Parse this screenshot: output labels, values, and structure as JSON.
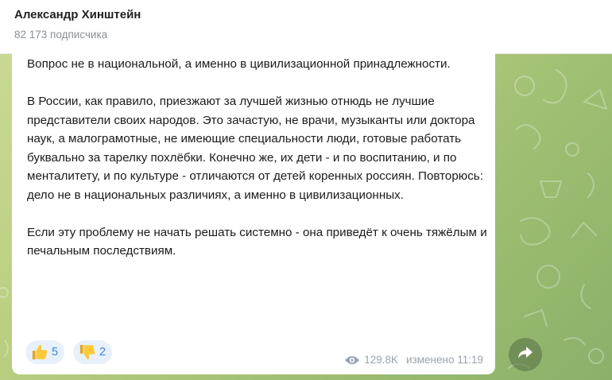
{
  "header": {
    "channel_name": "Александр Хинштейн",
    "subscribers": "82 173 подписчика"
  },
  "message": {
    "paragraphs": [
      "Вопрос не в национальной, а именно в цивилизационной принадлежности.",
      "В России, как правило, приезжают за лучшей жизнью отнюдь не лучшие представители своих народов. Это зачастую, не врачи, музыканты или доктора наук, а малограмотные, не имеющие специальности люди, готовые работать буквально за тарелку похлёбки. Конечно же, их дети - и по воспитанию, и по менталитету, и по культуре - отличаются от детей коренных россиян. Повторюсь: дело не в национальных различиях, а именно в цивилизационных.",
      "Если эту проблему не начать решать системно - она приведёт к очень тяжёлым и печальным последствиям."
    ],
    "reactions": [
      {
        "icon": "thumbs-up-icon",
        "count": "5"
      },
      {
        "icon": "thumbs-down-icon",
        "count": "2"
      }
    ],
    "views": "129.8K",
    "edited_time": "изменено 11:19"
  },
  "colors": {
    "reaction_bg": "#e8f1fb",
    "reaction_text": "#3a86d4",
    "meta_text": "#9aa3ab",
    "chat_bg": "#b8cd80"
  }
}
